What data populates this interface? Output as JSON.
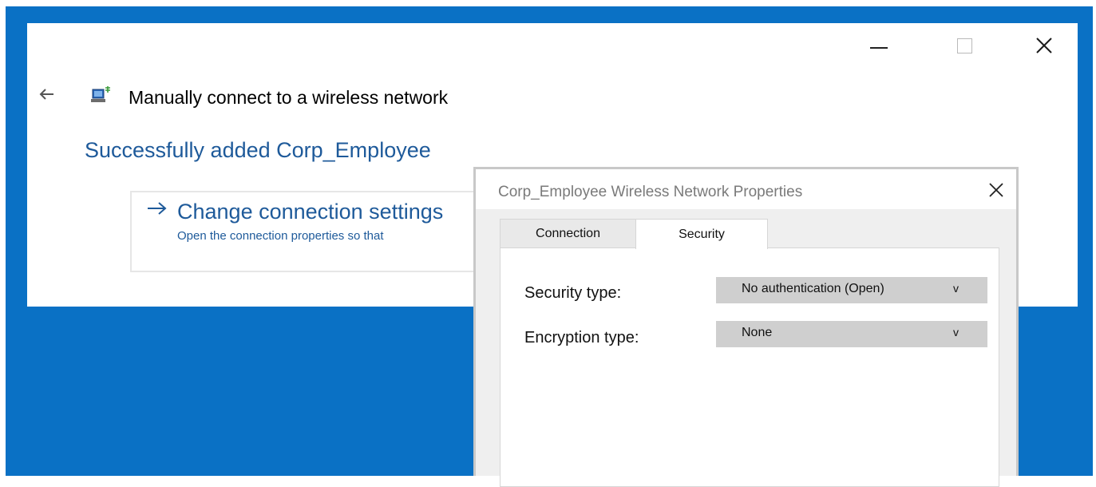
{
  "main_window": {
    "title": "Manually connect to a wireless network",
    "success_heading": "Successfully added Corp_Employee",
    "option": {
      "title": "Change connection settings",
      "description": "Open the connection properties so that"
    },
    "caption_icons": [
      "minimize-icon",
      "maximize-icon",
      "close-icon"
    ],
    "back_icon": "back-arrow-icon",
    "title_icon": "network-computer-icon"
  },
  "dialog": {
    "title": "Corp_Employee Wireless Network Properties",
    "tabs": [
      {
        "label": "Connection",
        "selected": false
      },
      {
        "label": "Security",
        "selected": true
      }
    ],
    "security_type": {
      "label": "Security type:",
      "value": "No authentication (Open)",
      "chevron": "v"
    },
    "encryption_type": {
      "label": "Encryption type:",
      "value": "None",
      "chevron": "v"
    }
  },
  "colors": {
    "desktop": "#0a71c5",
    "link": "#1e5a9a",
    "select_bg": "#cfcfcf"
  }
}
